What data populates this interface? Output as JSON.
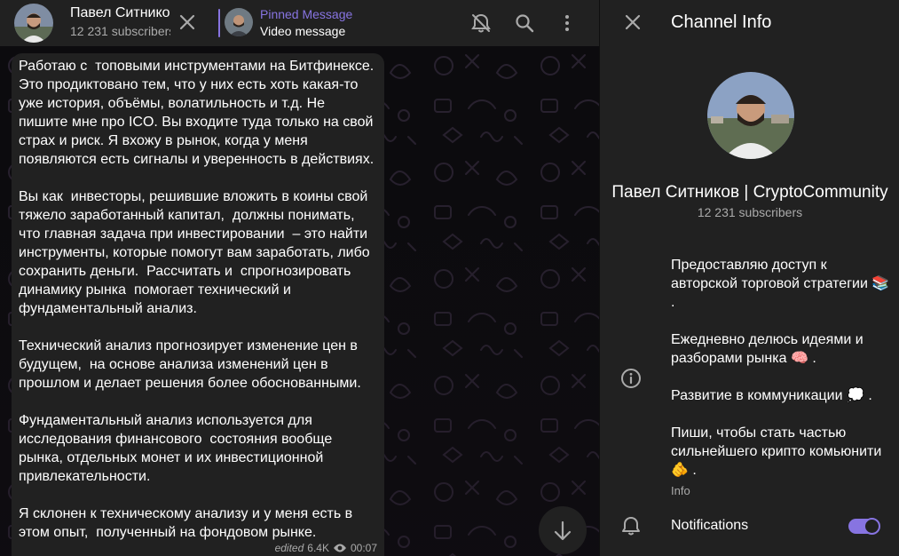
{
  "header": {
    "channel_title": "Павел Ситнико",
    "subscribers": "12 231 subscribers",
    "pinned_title": "Pinned Message",
    "pinned_text": "Video message"
  },
  "message": {
    "text": "Работаю с  топовыми инструментами на Битфинексе. Это продиктовано тем, что у них есть хоть какая-то уже история, объёмы, волатильность и т.д. Не пишите мне про ICO. Вы входите туда только на свой страх и риск. Я вхожу в рынок, когда у меня  появляются есть сигналы и уверенность в действиях.\n\nВы как  инвесторы, решившие вложить в коины свой тяжело заработанный капитал,  должны понимать, что главная задача при инвестировании  – это найти инструменты, которые помогут вам заработать, либо сохранить деньги.  Рассчитать и  спрогнозировать динамику рынка  помогает технический и фундаментальный анализ.\n\nТехнический анализ прогнозирует изменение цен в будущем,  на основе анализа изменений цен в прошлом и делает решения более обоснованными.\n\nФундаментальный анализ используется для исследования финансового  состояния вообще рынка, отдельных монет и их инвестиционной привлекательности.\n\nЯ склонен к техническому анализу и у меня есть в этом опыт,  полученный на фондовом рынке.",
    "edited": "edited",
    "views": "6.4K",
    "time": "00:07"
  },
  "side": {
    "title": "Channel Info",
    "name": "Павел Ситников | CryptoCommunity",
    "subscribers": "12 231 subscribers",
    "info": "Предоставляю доступ к авторской торговой стратегии 📚 .\n\nЕжедневно делюсь идеями и разборами рынка 🧠 .\n\nРазвитие в коммуникации 💭 .\n\nПиши, чтобы стать частью сильнейшего крипто комьюнити 🫵 .",
    "info_label": "Info",
    "notifications_label": "Notifications",
    "notifications_on": true
  },
  "colors": {
    "accent": "#8774e1",
    "panel": "#212121",
    "secondary_text": "#aaaaaa"
  },
  "icons": [
    "close-icon",
    "mute-bell-icon",
    "search-icon",
    "more-vertical-icon",
    "arrow-down-icon",
    "eye-icon",
    "info-icon",
    "bell-icon"
  ]
}
